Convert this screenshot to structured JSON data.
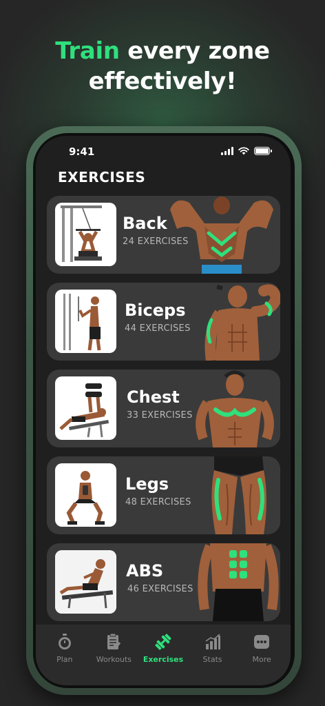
{
  "headline": {
    "accent": "Train",
    "rest_line1": " every zone",
    "line2": "effectively!"
  },
  "status_bar": {
    "time": "9:41"
  },
  "screen_title": "EXERCISES",
  "exercises": [
    {
      "name": "Back",
      "count": "24 EXERCISES"
    },
    {
      "name": "Biceps",
      "count": "44 EXERCISES"
    },
    {
      "name": "Chest",
      "count": "33 EXERCISES"
    },
    {
      "name": "Legs",
      "count": "48 EXERCISES"
    },
    {
      "name": "ABS",
      "count": "46 EXERCISES"
    }
  ],
  "tabs": [
    {
      "label": "Plan",
      "icon": "stopwatch-icon"
    },
    {
      "label": "Workouts",
      "icon": "clipboard-icon"
    },
    {
      "label": "Exercises",
      "icon": "dumbbell-icon",
      "active": true
    },
    {
      "label": "Stats",
      "icon": "bar-chart-icon"
    },
    {
      "label": "More",
      "icon": "more-dots-icon"
    }
  ],
  "colors": {
    "accent": "#2fe07d",
    "background": "#262626",
    "card": "#3a3a3a",
    "screen": "#1f1f1f"
  }
}
